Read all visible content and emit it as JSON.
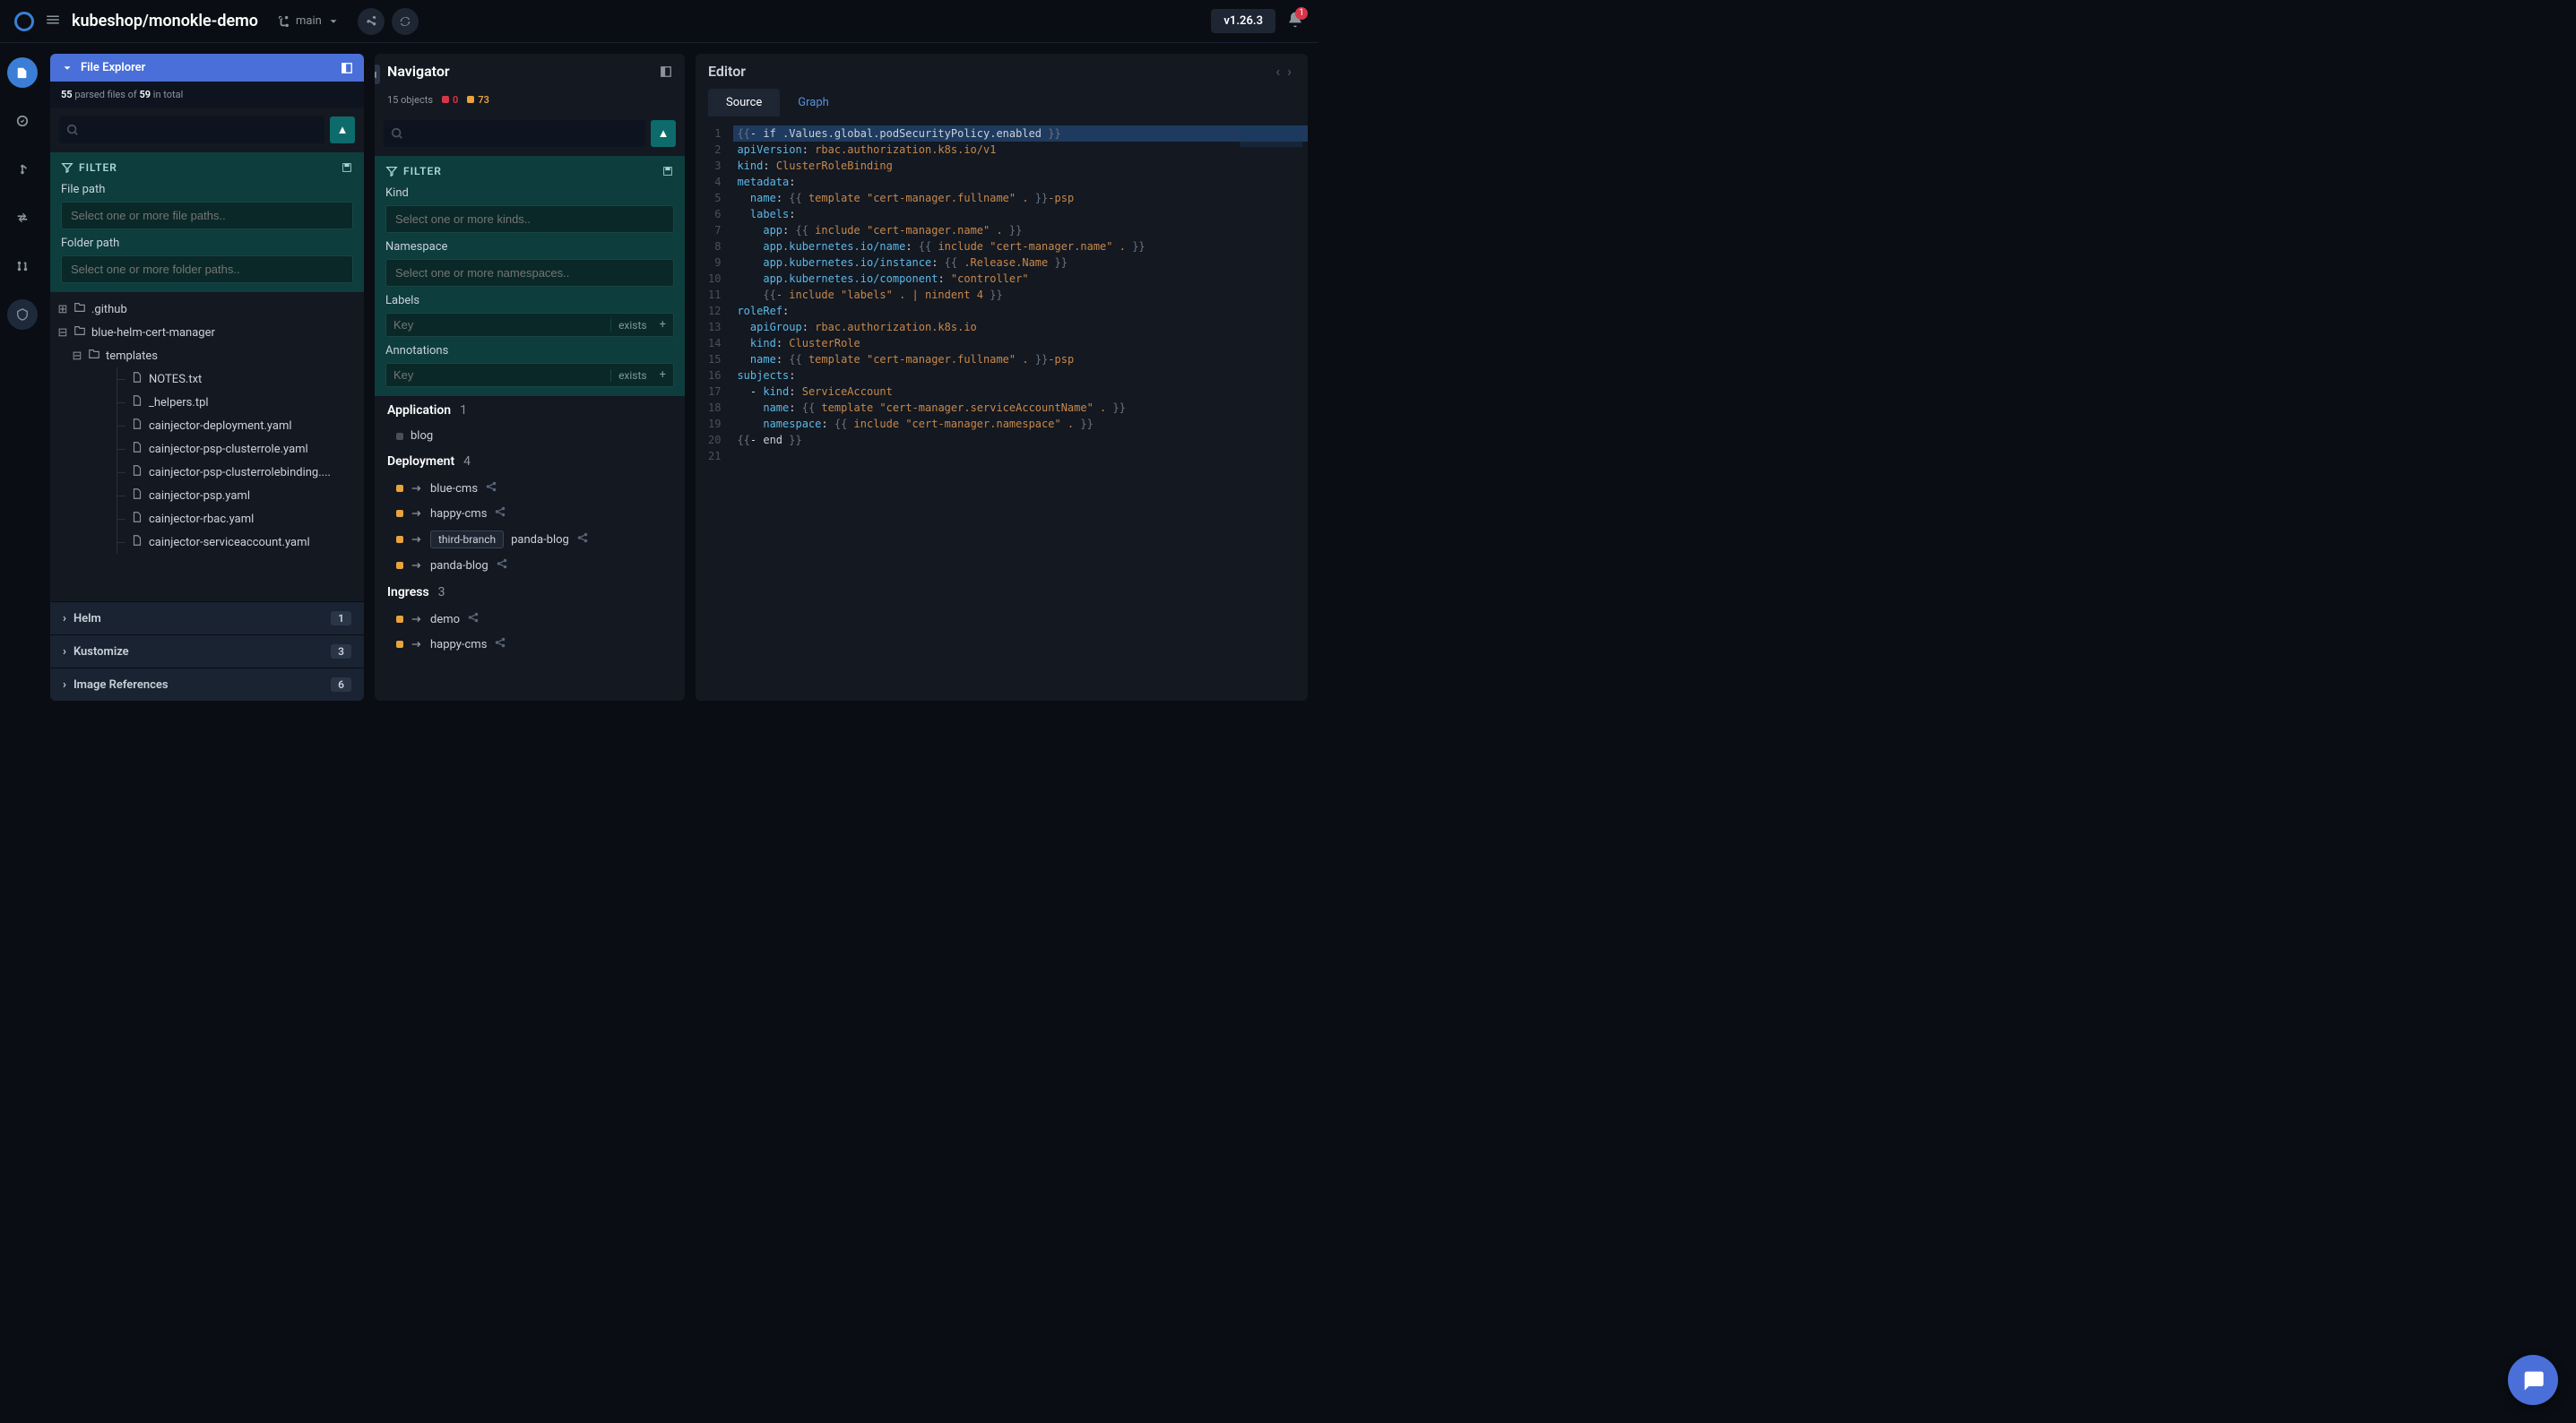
{
  "topbar": {
    "project": "kubeshop/monokle-demo",
    "branch": "main",
    "version": "v1.26.3",
    "notification_count": "1"
  },
  "explorer": {
    "title": "File Explorer",
    "parsed_count": "55",
    "parsed_label1": "parsed files of",
    "total_count": "59",
    "parsed_label2": "in total",
    "filter_label": "FILTER",
    "file_path_label": "File path",
    "file_path_placeholder": "Select one or more file paths..",
    "folder_path_label": "Folder path",
    "folder_path_placeholder": "Select one or more folder paths..",
    "tree": {
      "github": ".github",
      "blue_helm": "blue-helm-cert-manager",
      "templates": "templates",
      "files": [
        "NOTES.txt",
        "_helpers.tpl",
        "cainjector-deployment.yaml",
        "cainjector-psp-clusterrole.yaml",
        "cainjector-psp-clusterrolebinding....",
        "cainjector-psp.yaml",
        "cainjector-rbac.yaml",
        "cainjector-serviceaccount.yaml"
      ]
    },
    "accordions": [
      {
        "label": "Helm",
        "count": "1"
      },
      {
        "label": "Kustomize",
        "count": "3"
      },
      {
        "label": "Image References",
        "count": "6"
      }
    ]
  },
  "navigator": {
    "title": "Navigator",
    "objects_label": "15 objects",
    "errors": "0",
    "warnings": "73",
    "filter_label": "FILTER",
    "kind_label": "Kind",
    "kind_placeholder": "Select one or more kinds..",
    "namespace_label": "Namespace",
    "namespace_placeholder": "Select one or more namespaces..",
    "labels_label": "Labels",
    "annotations_label": "Annotations",
    "key_placeholder": "Key",
    "exists_label": "exists",
    "groups": [
      {
        "name": "Application",
        "count": "1",
        "items": [
          {
            "name": "blog",
            "dot": "gray"
          }
        ]
      },
      {
        "name": "Deployment",
        "count": "4",
        "items": [
          {
            "name": "blue-cms",
            "dot": "yellow",
            "share": true
          },
          {
            "name": "happy-cms",
            "dot": "yellow",
            "share": true
          },
          {
            "name": "panda-blog",
            "dot": "yellow",
            "share": true,
            "branch": "third-branch"
          },
          {
            "name": "panda-blog",
            "dot": "yellow",
            "share": true
          }
        ]
      },
      {
        "name": "Ingress",
        "count": "3",
        "items": [
          {
            "name": "demo",
            "dot": "yellow",
            "share": true
          },
          {
            "name": "happy-cms",
            "dot": "yellow",
            "share": true
          }
        ]
      }
    ]
  },
  "editor": {
    "title": "Editor",
    "tabs": {
      "source": "Source",
      "graph": "Graph"
    },
    "code": [
      {
        "hl": true,
        "tokens": [
          {
            "c": "brace",
            "t": "{{"
          },
          {
            "c": "tpl",
            "t": "- if .Values.global.podSecurityPolicy.enabled "
          },
          {
            "c": "brace",
            "t": "}}"
          }
        ]
      },
      {
        "tokens": [
          {
            "c": "key",
            "t": "apiVersion"
          },
          {
            "c": "tpl",
            "t": ": "
          },
          {
            "c": "str",
            "t": "rbac.authorization.k8s.io/v1"
          }
        ]
      },
      {
        "tokens": [
          {
            "c": "key",
            "t": "kind"
          },
          {
            "c": "tpl",
            "t": ": "
          },
          {
            "c": "str",
            "t": "ClusterRoleBinding"
          }
        ]
      },
      {
        "tokens": [
          {
            "c": "key",
            "t": "metadata"
          },
          {
            "c": "tpl",
            "t": ":"
          }
        ]
      },
      {
        "tokens": [
          {
            "c": "tpl",
            "t": "  "
          },
          {
            "c": "key",
            "t": "name"
          },
          {
            "c": "tpl",
            "t": ": "
          },
          {
            "c": "brace",
            "t": "{{"
          },
          {
            "c": "str",
            "t": " template \"cert-manager.fullname\" . "
          },
          {
            "c": "brace",
            "t": "}}"
          },
          {
            "c": "str",
            "t": "-psp"
          }
        ]
      },
      {
        "tokens": [
          {
            "c": "tpl",
            "t": "  "
          },
          {
            "c": "key",
            "t": "labels"
          },
          {
            "c": "tpl",
            "t": ":"
          }
        ]
      },
      {
        "tokens": [
          {
            "c": "tpl",
            "t": "    "
          },
          {
            "c": "key",
            "t": "app"
          },
          {
            "c": "tpl",
            "t": ": "
          },
          {
            "c": "brace",
            "t": "{{"
          },
          {
            "c": "str",
            "t": " include \"cert-manager.name\" . "
          },
          {
            "c": "brace",
            "t": "}}"
          }
        ]
      },
      {
        "tokens": [
          {
            "c": "tpl",
            "t": "    "
          },
          {
            "c": "key",
            "t": "app.kubernetes.io/name"
          },
          {
            "c": "tpl",
            "t": ": "
          },
          {
            "c": "brace",
            "t": "{{"
          },
          {
            "c": "str",
            "t": " include \"cert-manager.name\" . "
          },
          {
            "c": "brace",
            "t": "}}"
          }
        ]
      },
      {
        "tokens": [
          {
            "c": "tpl",
            "t": "    "
          },
          {
            "c": "key",
            "t": "app.kubernetes.io/instance"
          },
          {
            "c": "tpl",
            "t": ": "
          },
          {
            "c": "brace",
            "t": "{{"
          },
          {
            "c": "str",
            "t": " .Release.Name "
          },
          {
            "c": "brace",
            "t": "}}"
          }
        ]
      },
      {
        "tokens": [
          {
            "c": "tpl",
            "t": "    "
          },
          {
            "c": "key",
            "t": "app.kubernetes.io/component"
          },
          {
            "c": "tpl",
            "t": ": "
          },
          {
            "c": "str",
            "t": "\"controller\""
          }
        ]
      },
      {
        "tokens": [
          {
            "c": "tpl",
            "t": "    "
          },
          {
            "c": "brace",
            "t": "{{"
          },
          {
            "c": "str",
            "t": "- include \"labels\" . | nindent 4 "
          },
          {
            "c": "brace",
            "t": "}}"
          }
        ]
      },
      {
        "tokens": [
          {
            "c": "key",
            "t": "roleRef"
          },
          {
            "c": "tpl",
            "t": ":"
          }
        ]
      },
      {
        "tokens": [
          {
            "c": "tpl",
            "t": "  "
          },
          {
            "c": "key",
            "t": "apiGroup"
          },
          {
            "c": "tpl",
            "t": ": "
          },
          {
            "c": "str",
            "t": "rbac.authorization.k8s.io"
          }
        ]
      },
      {
        "tokens": [
          {
            "c": "tpl",
            "t": "  "
          },
          {
            "c": "key",
            "t": "kind"
          },
          {
            "c": "tpl",
            "t": ": "
          },
          {
            "c": "str",
            "t": "ClusterRole"
          }
        ]
      },
      {
        "tokens": [
          {
            "c": "tpl",
            "t": "  "
          },
          {
            "c": "key",
            "t": "name"
          },
          {
            "c": "tpl",
            "t": ": "
          },
          {
            "c": "brace",
            "t": "{{"
          },
          {
            "c": "str",
            "t": " template \"cert-manager.fullname\" . "
          },
          {
            "c": "brace",
            "t": "}}"
          },
          {
            "c": "str",
            "t": "-psp"
          }
        ]
      },
      {
        "tokens": [
          {
            "c": "key",
            "t": "subjects"
          },
          {
            "c": "tpl",
            "t": ":"
          }
        ]
      },
      {
        "tokens": [
          {
            "c": "tpl",
            "t": "  - "
          },
          {
            "c": "key",
            "t": "kind"
          },
          {
            "c": "tpl",
            "t": ": "
          },
          {
            "c": "str",
            "t": "ServiceAccount"
          }
        ]
      },
      {
        "tokens": [
          {
            "c": "tpl",
            "t": "    "
          },
          {
            "c": "key",
            "t": "name"
          },
          {
            "c": "tpl",
            "t": ": "
          },
          {
            "c": "brace",
            "t": "{{"
          },
          {
            "c": "str",
            "t": " template \"cert-manager.serviceAccountName\" . "
          },
          {
            "c": "brace",
            "t": "}}"
          }
        ]
      },
      {
        "tokens": [
          {
            "c": "tpl",
            "t": "    "
          },
          {
            "c": "key",
            "t": "namespace"
          },
          {
            "c": "tpl",
            "t": ": "
          },
          {
            "c": "brace",
            "t": "{{"
          },
          {
            "c": "str",
            "t": " include \"cert-manager.namespace\" . "
          },
          {
            "c": "brace",
            "t": "}}"
          }
        ]
      },
      {
        "tokens": [
          {
            "c": "brace",
            "t": "{{"
          },
          {
            "c": "tpl",
            "t": "- end "
          },
          {
            "c": "brace",
            "t": "}}"
          }
        ]
      },
      {
        "tokens": []
      }
    ]
  }
}
